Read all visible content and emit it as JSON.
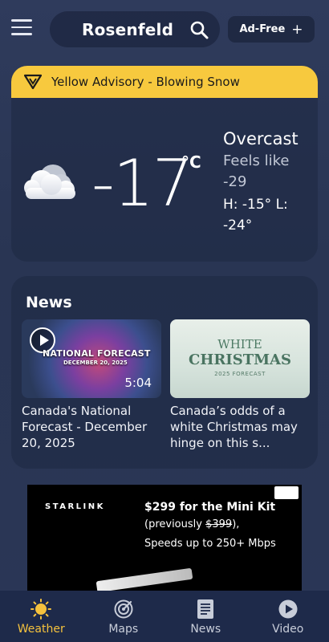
{
  "header": {
    "city": "Rosenfeld",
    "adfree_label": "Ad-Free",
    "adfree_plus": "+"
  },
  "alert": {
    "text": "Yellow Advisory - Blowing Snow",
    "color": "#f7c93e"
  },
  "current": {
    "icon": "cloud-icon",
    "temperature": "-17",
    "unit": "°C",
    "condition": "Overcast",
    "feels_like": "Feels like -29",
    "hi_lo": "H: -15° L: -24°"
  },
  "news": {
    "title": "News",
    "stories": [
      {
        "thumb_title": "NATIONAL FORECAST",
        "thumb_date": "DECEMBER 20, 2025",
        "duration": "5:04",
        "headline": "Canada's National Forecast - December 20, 2025"
      },
      {
        "thumb_line1": "WHITE",
        "thumb_line2": "CHRISTMAS",
        "thumb_line3": "2025 FORECAST",
        "headline": "Canada’s odds of a white Christmas may hinge on this s..."
      }
    ]
  },
  "ad": {
    "brand": "STARLINK",
    "headline": "$299 for the Mini Kit",
    "line2_prefix": "(previously ",
    "line2_strike": "$399",
    "line2_suffix": "),",
    "line3": "Speeds up to 250+ Mbps"
  },
  "nav": {
    "items": [
      {
        "label": "Weather",
        "icon": "sun-icon",
        "active": true
      },
      {
        "label": "Maps",
        "icon": "radar-icon",
        "active": false
      },
      {
        "label": "News",
        "icon": "newspaper-icon",
        "active": false
      },
      {
        "label": "Video",
        "icon": "play-icon",
        "active": false
      }
    ]
  },
  "colors": {
    "accent": "#f5c23d",
    "background": "#2a3656"
  }
}
